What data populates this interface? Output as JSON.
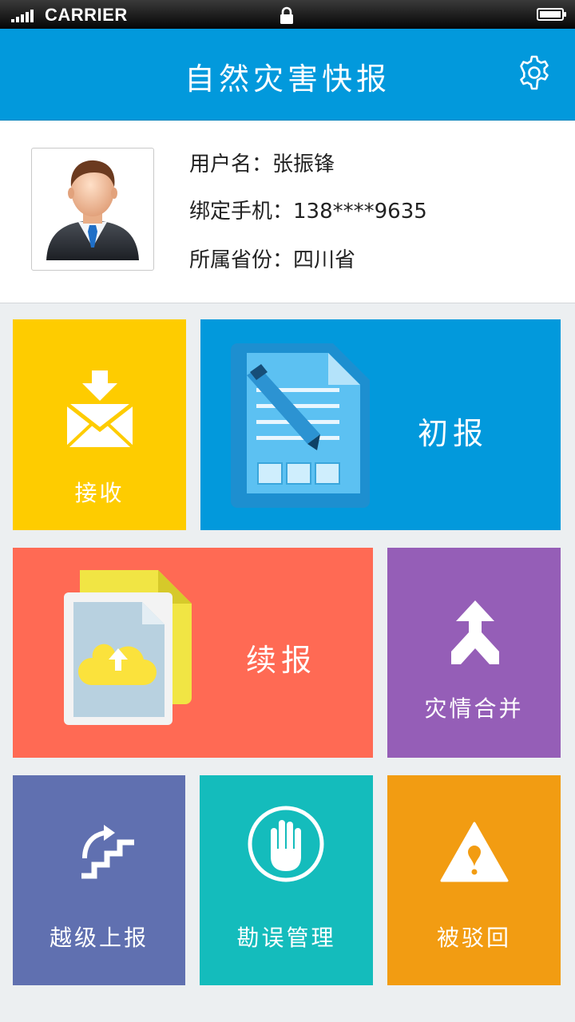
{
  "status_bar": {
    "carrier": "CARRIER",
    "battery_level": 1.0,
    "icons": [
      "signal-icon",
      "lock-icon",
      "battery-icon"
    ]
  },
  "header": {
    "title": "自然灾害快报",
    "settings_icon": "gear-icon",
    "color": "#0299dc"
  },
  "profile": {
    "avatar_icon": "businessman-avatar",
    "username_label": "用户名：",
    "username": "张振锋",
    "phone_label": "绑定手机：",
    "phone": "138****9635",
    "province_label": "所属省份：",
    "province": "四川省"
  },
  "tiles": [
    {
      "label": "接收",
      "icon": "mail-receive-icon",
      "color": "#fecc00"
    },
    {
      "label": "初报",
      "icon": "document-edit-icon",
      "color": "#0299dc"
    },
    {
      "label": "续报",
      "icon": "cloud-upload-document-icon",
      "color": "#ff6a54"
    },
    {
      "label": "灾情合并",
      "icon": "merge-arrow-icon",
      "color": "#955eb7"
    },
    {
      "label": "越级上报",
      "icon": "stairs-up-icon",
      "color": "#6070b0"
    },
    {
      "label": "勘误管理",
      "icon": "hand-stop-icon",
      "color": "#14bcbc"
    },
    {
      "label": "被驳回",
      "icon": "warning-icon",
      "color": "#f29c12"
    }
  ]
}
